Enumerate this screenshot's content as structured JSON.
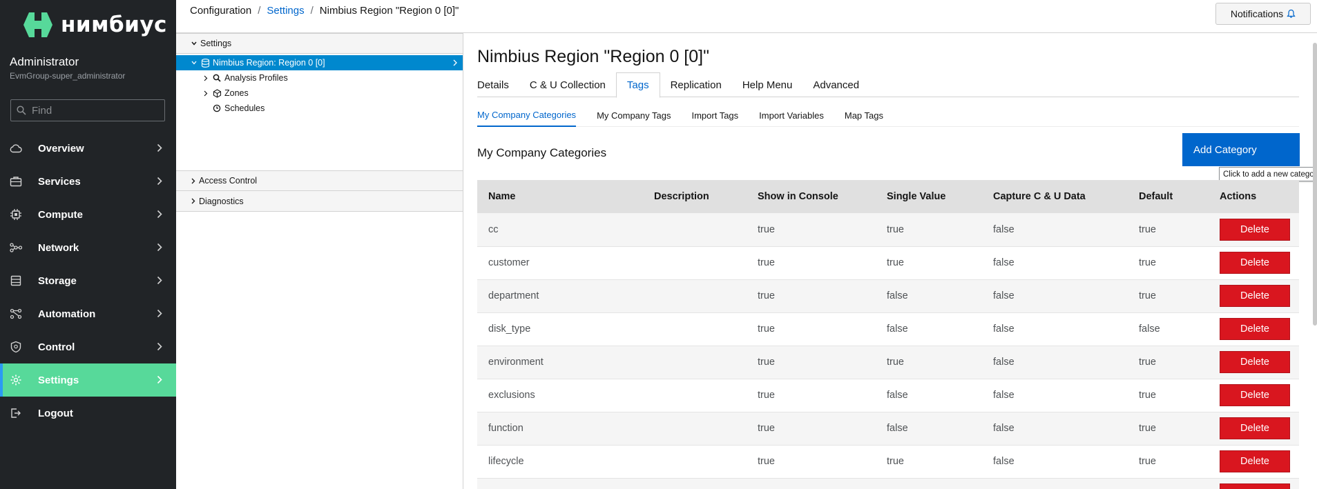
{
  "brand": {
    "name": "нимбиус",
    "logo_color": "#57d99a"
  },
  "user": {
    "name": "Administrator",
    "group": "EvmGroup-super_administrator"
  },
  "search": {
    "placeholder": "Find"
  },
  "nav": {
    "items": [
      {
        "label": "Overview",
        "icon": "cloud-icon"
      },
      {
        "label": "Services",
        "icon": "briefcase-icon"
      },
      {
        "label": "Compute",
        "icon": "cpu-icon"
      },
      {
        "label": "Network",
        "icon": "network-icon"
      },
      {
        "label": "Storage",
        "icon": "database-icon"
      },
      {
        "label": "Automation",
        "icon": "automation-icon"
      },
      {
        "label": "Control",
        "icon": "shield-icon"
      },
      {
        "label": "Settings",
        "icon": "gear-icon",
        "active": true
      },
      {
        "label": "Logout",
        "icon": "logout-icon"
      }
    ]
  },
  "breadcrumb": {
    "root": "Configuration",
    "section": "Settings",
    "current": "Nimbius Region \"Region 0 [0]\""
  },
  "notifications": {
    "label": "Notifications"
  },
  "tree": {
    "settings_header": "Settings",
    "nodes": {
      "root": "Nimbius Region: Region 0 [0]",
      "analysis_profiles": "Analysis Profiles",
      "zones": "Zones",
      "schedules": "Schedules"
    },
    "access_control_header": "Access Control",
    "diagnostics_header": "Diagnostics"
  },
  "main": {
    "title": "Nimbius Region \"Region 0 [0]\"",
    "tabs": [
      "Details",
      "C & U Collection",
      "Tags",
      "Replication",
      "Help Menu",
      "Advanced"
    ],
    "active_tab": "Tags",
    "subtabs": [
      "My Company Categories",
      "My Company Tags",
      "Import Tags",
      "Import Variables",
      "Map Tags"
    ],
    "active_subtab": "My Company Categories",
    "section_title": "My Company Categories",
    "add_button": "Add Category",
    "tooltip": "Click to add a new categor",
    "table": {
      "headers": [
        "Name",
        "Description",
        "Show in Console",
        "Single Value",
        "Capture C & U Data",
        "Default",
        "Actions"
      ],
      "delete_label": "Delete",
      "rows": [
        {
          "name": "cc",
          "description": "",
          "show": "true",
          "single": "true",
          "capture": "false",
          "default": "true"
        },
        {
          "name": "customer",
          "description": "",
          "show": "true",
          "single": "true",
          "capture": "false",
          "default": "true"
        },
        {
          "name": "department",
          "description": "",
          "show": "true",
          "single": "false",
          "capture": "false",
          "default": "true"
        },
        {
          "name": "disk_type",
          "description": "",
          "show": "true",
          "single": "false",
          "capture": "false",
          "default": "false"
        },
        {
          "name": "environment",
          "description": "",
          "show": "true",
          "single": "true",
          "capture": "false",
          "default": "true"
        },
        {
          "name": "exclusions",
          "description": "",
          "show": "true",
          "single": "false",
          "capture": "false",
          "default": "true"
        },
        {
          "name": "function",
          "description": "",
          "show": "true",
          "single": "false",
          "capture": "false",
          "default": "true"
        },
        {
          "name": "lifecycle",
          "description": "",
          "show": "true",
          "single": "true",
          "capture": "false",
          "default": "true"
        },
        {
          "name": "",
          "description": "",
          "show": "",
          "single": "",
          "capture": "",
          "default": ""
        }
      ]
    }
  },
  "colors": {
    "nav_bg": "#212427",
    "nav_active": "#57d99a",
    "tree_selected": "#0088ce",
    "link": "#0066cc",
    "danger": "#d9161f"
  }
}
